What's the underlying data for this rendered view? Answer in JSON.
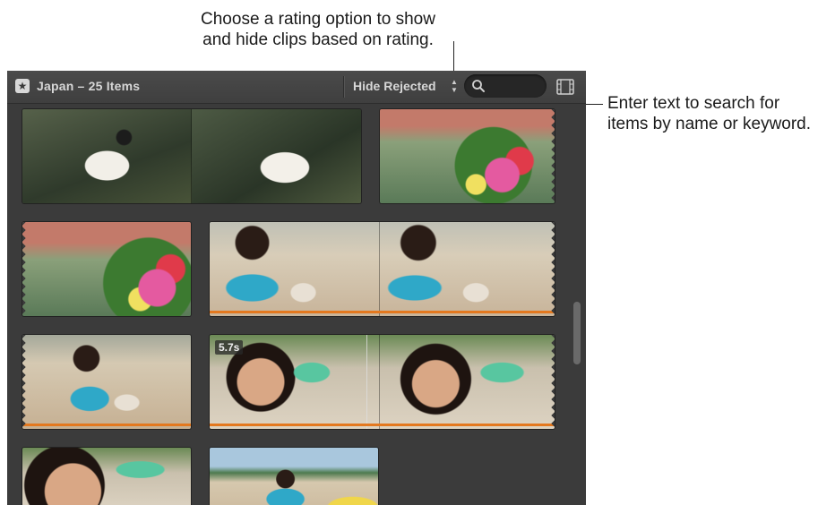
{
  "callouts": {
    "rating_line1": "Choose a rating option to show",
    "rating_line2": "and hide clips based on rating.",
    "search_line1": "Enter text to search for",
    "search_line2": "items by name or keyword."
  },
  "toolbar": {
    "library_title": "Japan – 25 Items",
    "filter_label": "Hide Rejected",
    "search_value": "",
    "icons": [
      "star-icon",
      "updown-chevron-icon",
      "search-icon",
      "filmstrip-icon"
    ]
  },
  "clips": [
    {
      "name": "swan",
      "frames": 2
    },
    {
      "name": "flowers-bridge-1",
      "frames": 1
    },
    {
      "name": "flowers-bridge-2",
      "frames": 1
    },
    {
      "name": "kids-beach-1",
      "frames": 2
    },
    {
      "name": "kids-beach-2",
      "frames": 1
    },
    {
      "name": "woman-goggles",
      "frames": 2,
      "duration": "5.7s"
    },
    {
      "name": "woman-goggles-closeup",
      "frames": 1
    },
    {
      "name": "boy-beach",
      "frames": 1
    }
  ],
  "colors": {
    "accent_orange": "#e3781f",
    "panel": "#3b3b3b"
  }
}
